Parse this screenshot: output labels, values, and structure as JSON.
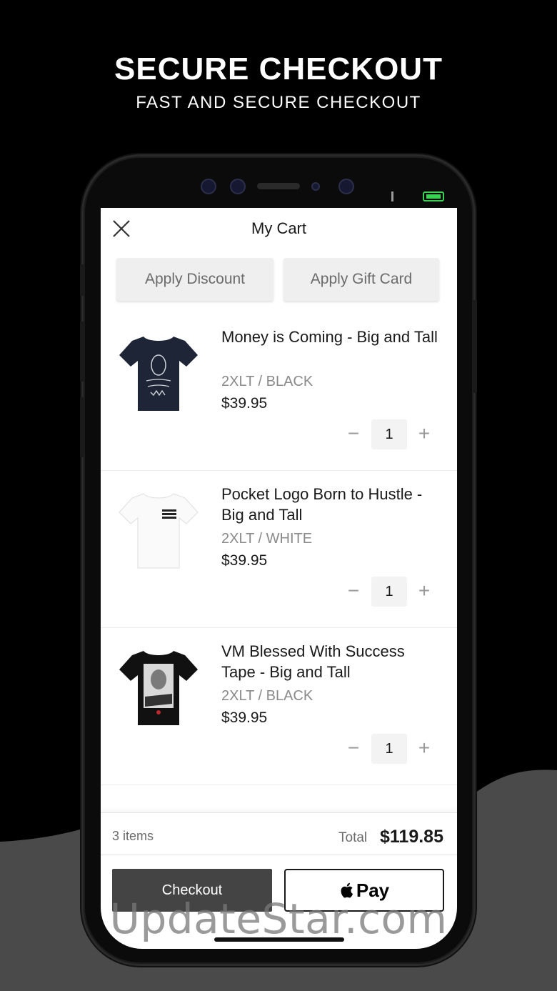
{
  "promo": {
    "headline": "SECURE CHECKOUT",
    "subheadline": "FAST AND SECURE CHECKOUT"
  },
  "colors": {
    "background_top": "#000000",
    "background_bottom": "#4a4a4a",
    "checkout_button": "#444444",
    "battery": "#39d353"
  },
  "cart": {
    "title": "My Cart",
    "close_icon": "close-icon",
    "apply_discount_label": "Apply Discount",
    "apply_gift_card_label": "Apply Gift Card",
    "items": [
      {
        "name": "Money is Coming - Big and Tall",
        "variant": "2XLT / BLACK",
        "price": "$39.95",
        "quantity": "1",
        "shirt_color": "navy"
      },
      {
        "name": "Pocket Logo Born to Hustle - Big and Tall",
        "variant": "2XLT / WHITE",
        "price": "$39.95",
        "quantity": "1",
        "shirt_color": "white"
      },
      {
        "name": "VM Blessed With Success Tape - Big and Tall",
        "variant": "2XLT / BLACK",
        "price": "$39.95",
        "quantity": "1",
        "shirt_color": "black"
      }
    ],
    "quantity_minus": "−",
    "quantity_plus": "+",
    "items_count": "3 items",
    "total_label": "Total",
    "total_value": "$119.85",
    "checkout_label": "Checkout",
    "apple_pay_label": "Pay"
  },
  "watermark": "UpdateStar.com"
}
